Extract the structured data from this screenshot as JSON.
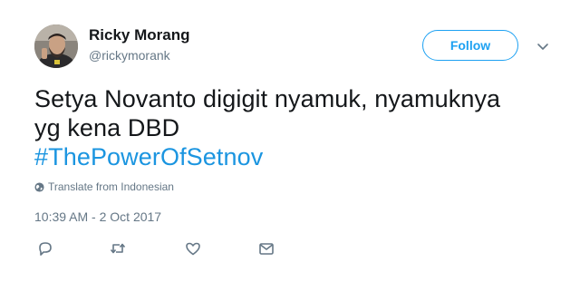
{
  "author": {
    "name": "Ricky Morang",
    "handle": "@rickymorank"
  },
  "follow_label": "Follow",
  "tweet": {
    "line1": "Setya Novanto digigit nyamuk, nyamuknya",
    "line2": "yg kena DBD",
    "hashtag": "#ThePowerOfSetnov"
  },
  "translate_label": "Translate from Indonesian",
  "timestamp": "10:39 AM - 2 Oct 2017",
  "icons": {
    "reply": "reply-icon",
    "retweet": "retweet-icon",
    "like": "heart-icon",
    "dm": "envelope-icon",
    "globe": "globe-icon",
    "caret": "chevron-down-icon"
  },
  "colors": {
    "accent": "#1da1f2",
    "hashtag": "#1b95e0",
    "secondary_text": "#657786",
    "primary_text": "#14171a"
  }
}
